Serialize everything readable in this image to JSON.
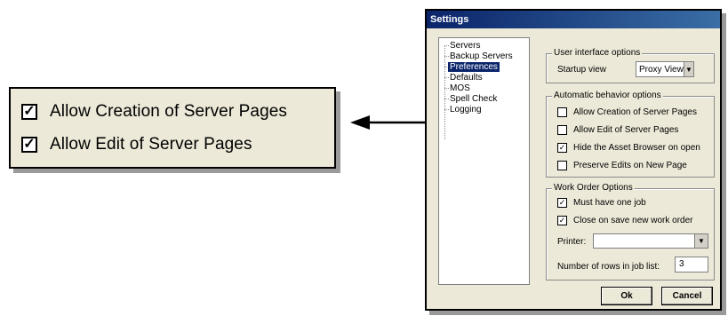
{
  "callout": {
    "items": [
      {
        "label": "Allow Creation of Server Pages",
        "checked": true
      },
      {
        "label": "Allow Edit of Server Pages",
        "checked": true
      }
    ]
  },
  "window": {
    "title": "Settings",
    "tree": [
      "Servers",
      "Backup Servers",
      "Preferences",
      "Defaults",
      "MOS",
      "Spell Check",
      "Logging"
    ],
    "selected_tree_item": "Preferences",
    "ui_options": {
      "title": "User interface options",
      "startup_label": "Startup view",
      "startup_value": "Proxy View"
    },
    "auto_options": {
      "title": "Automatic behavior options",
      "items": [
        {
          "label": "Allow Creation of Server Pages",
          "checked": false
        },
        {
          "label": "Allow Edit of Server Pages",
          "checked": false
        },
        {
          "label": "Hide the Asset Browser on open",
          "checked": true
        },
        {
          "label": "Preserve Edits on New Page",
          "checked": false
        }
      ]
    },
    "work_order": {
      "title": "Work Order Options",
      "items": [
        {
          "label": "Must have one job",
          "checked": true
        },
        {
          "label": "Close on save new work order",
          "checked": true
        }
      ],
      "printer_label": "Printer:",
      "printer_value": "",
      "rows_label": "Number of rows in job list:",
      "rows_value": "3"
    },
    "buttons": {
      "ok": "Ok",
      "cancel": "Cancel"
    }
  }
}
